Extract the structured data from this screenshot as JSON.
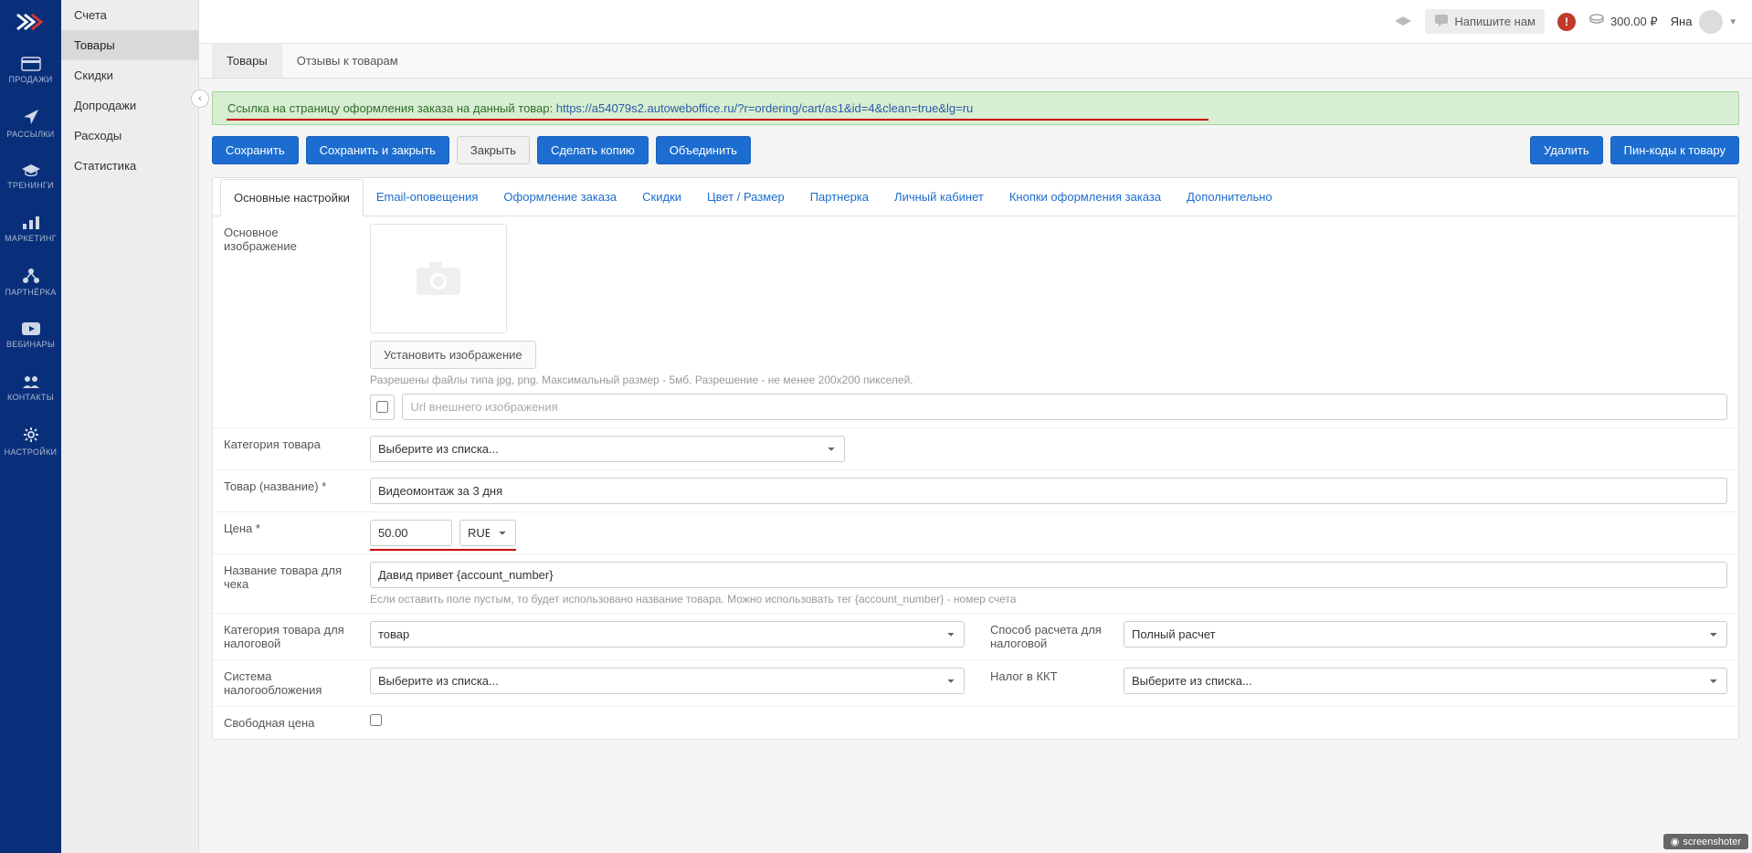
{
  "main_nav": [
    {
      "label": "ПРОДАЖИ"
    },
    {
      "label": "РАССЫЛКИ"
    },
    {
      "label": "ТРЕНИНГИ"
    },
    {
      "label": "МАРКЕТИНГ"
    },
    {
      "label": "ПАРТНЁРКА"
    },
    {
      "label": "ВЕБИНАРЫ"
    },
    {
      "label": "КОНТАКТЫ"
    },
    {
      "label": "НАСТРОЙКИ"
    }
  ],
  "sub_nav": [
    {
      "label": "Счета"
    },
    {
      "label": "Товары"
    },
    {
      "label": "Скидки"
    },
    {
      "label": "Допродажи"
    },
    {
      "label": "Расходы"
    },
    {
      "label": "Статистика"
    }
  ],
  "topbar": {
    "contact": "Напишите нам",
    "alert": "!",
    "balance": "300.00 ₽",
    "user": "Яна"
  },
  "tabs": [
    {
      "label": "Товары"
    },
    {
      "label": "Отзывы к товарам"
    }
  ],
  "notice": {
    "prefix": "Ссылка на страницу оформления заказа на данный товар: ",
    "link": "https://a54079s2.autoweboffice.ru/?r=ordering/cart/as1&id=4&clean=true&lg=ru"
  },
  "buttons": {
    "save": "Сохранить",
    "save_close": "Сохранить и закрыть",
    "close": "Закрыть",
    "copy": "Сделать копию",
    "merge": "Объединить",
    "delete": "Удалить",
    "pincodes": "Пин-коды к товару"
  },
  "subtabs": [
    "Основные настройки",
    "Email-оповещения",
    "Оформление заказа",
    "Скидки",
    "Цвет / Размер",
    "Партнерка",
    "Личный кабинет",
    "Кнопки оформления заказа",
    "Дополнительно"
  ],
  "form": {
    "main_image": {
      "label": "Основное изображение",
      "set_btn": "Установить изображение",
      "hint": "Разрешены файлы типа jpg, png. Максимальный размер - 5мб. Разрешение - не менее 200x200 пикселей.",
      "url_placeholder": "Url внешнего изображения"
    },
    "category": {
      "label": "Категория товара",
      "placeholder": "Выберите из списка..."
    },
    "name": {
      "label": "Товар (название) *",
      "value": "Видеомонтаж за 3 дня"
    },
    "price": {
      "label": "Цена *",
      "value": "50.00",
      "currency": "RUB"
    },
    "receipt_name": {
      "label": "Название товара для чека",
      "value": "Давид привет {account_number}",
      "hint": "Если оставить поле пустым, то будет использовано название товара. Можно использовать тег {account_number} - номер счета"
    },
    "tax_category": {
      "label": "Категория товара для налоговой",
      "value": "товар"
    },
    "calc_method": {
      "label": "Способ расчета для налоговой",
      "value": "Полный расчет"
    },
    "tax_system": {
      "label": "Система налогообложения",
      "placeholder": "Выберите из списка..."
    },
    "kkt_tax": {
      "label": "Налог в ККТ",
      "placeholder": "Выберите из списка..."
    },
    "free_price": {
      "label": "Свободная цена"
    }
  },
  "screenshoter": "screenshoter"
}
